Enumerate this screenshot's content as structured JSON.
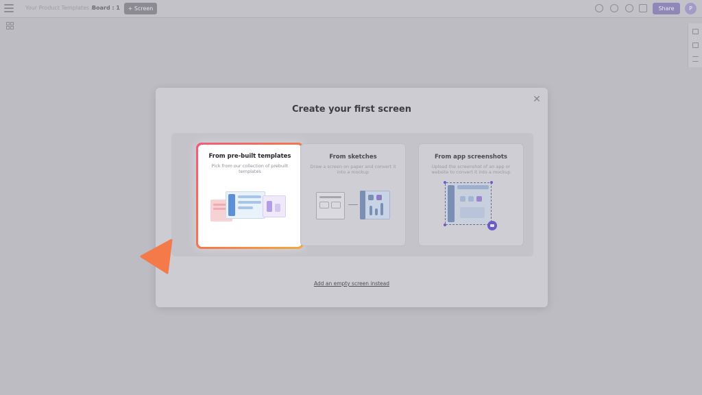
{
  "topbar": {
    "crumb": "Your Product Templates  /",
    "board": "Board : 1",
    "screen_button": "+ Screen",
    "share_button": "Share",
    "avatar": "P",
    "icons": [
      "preview-icon",
      "search-icon",
      "history-icon",
      "export-icon"
    ]
  },
  "modal": {
    "title": "Create your first screen",
    "close": "✕",
    "options": [
      {
        "title": "From pre-built templates",
        "description": "Pick from our collection of prebuilt templates",
        "selected": true
      },
      {
        "title": "From sketches",
        "description": "Draw a screen on paper and convert it into a mockup",
        "selected": false
      },
      {
        "title": "From app screenshots",
        "description": "Upload the screenshot of an app or website to convert it into a mockup",
        "selected": false
      }
    ],
    "empty_link": "Add an empty screen instead"
  },
  "colors": {
    "highlight_gradient": [
      "#f25a78",
      "#f4a93a"
    ],
    "pointer": "#f47a4a",
    "accent": "#6b5bc8"
  }
}
